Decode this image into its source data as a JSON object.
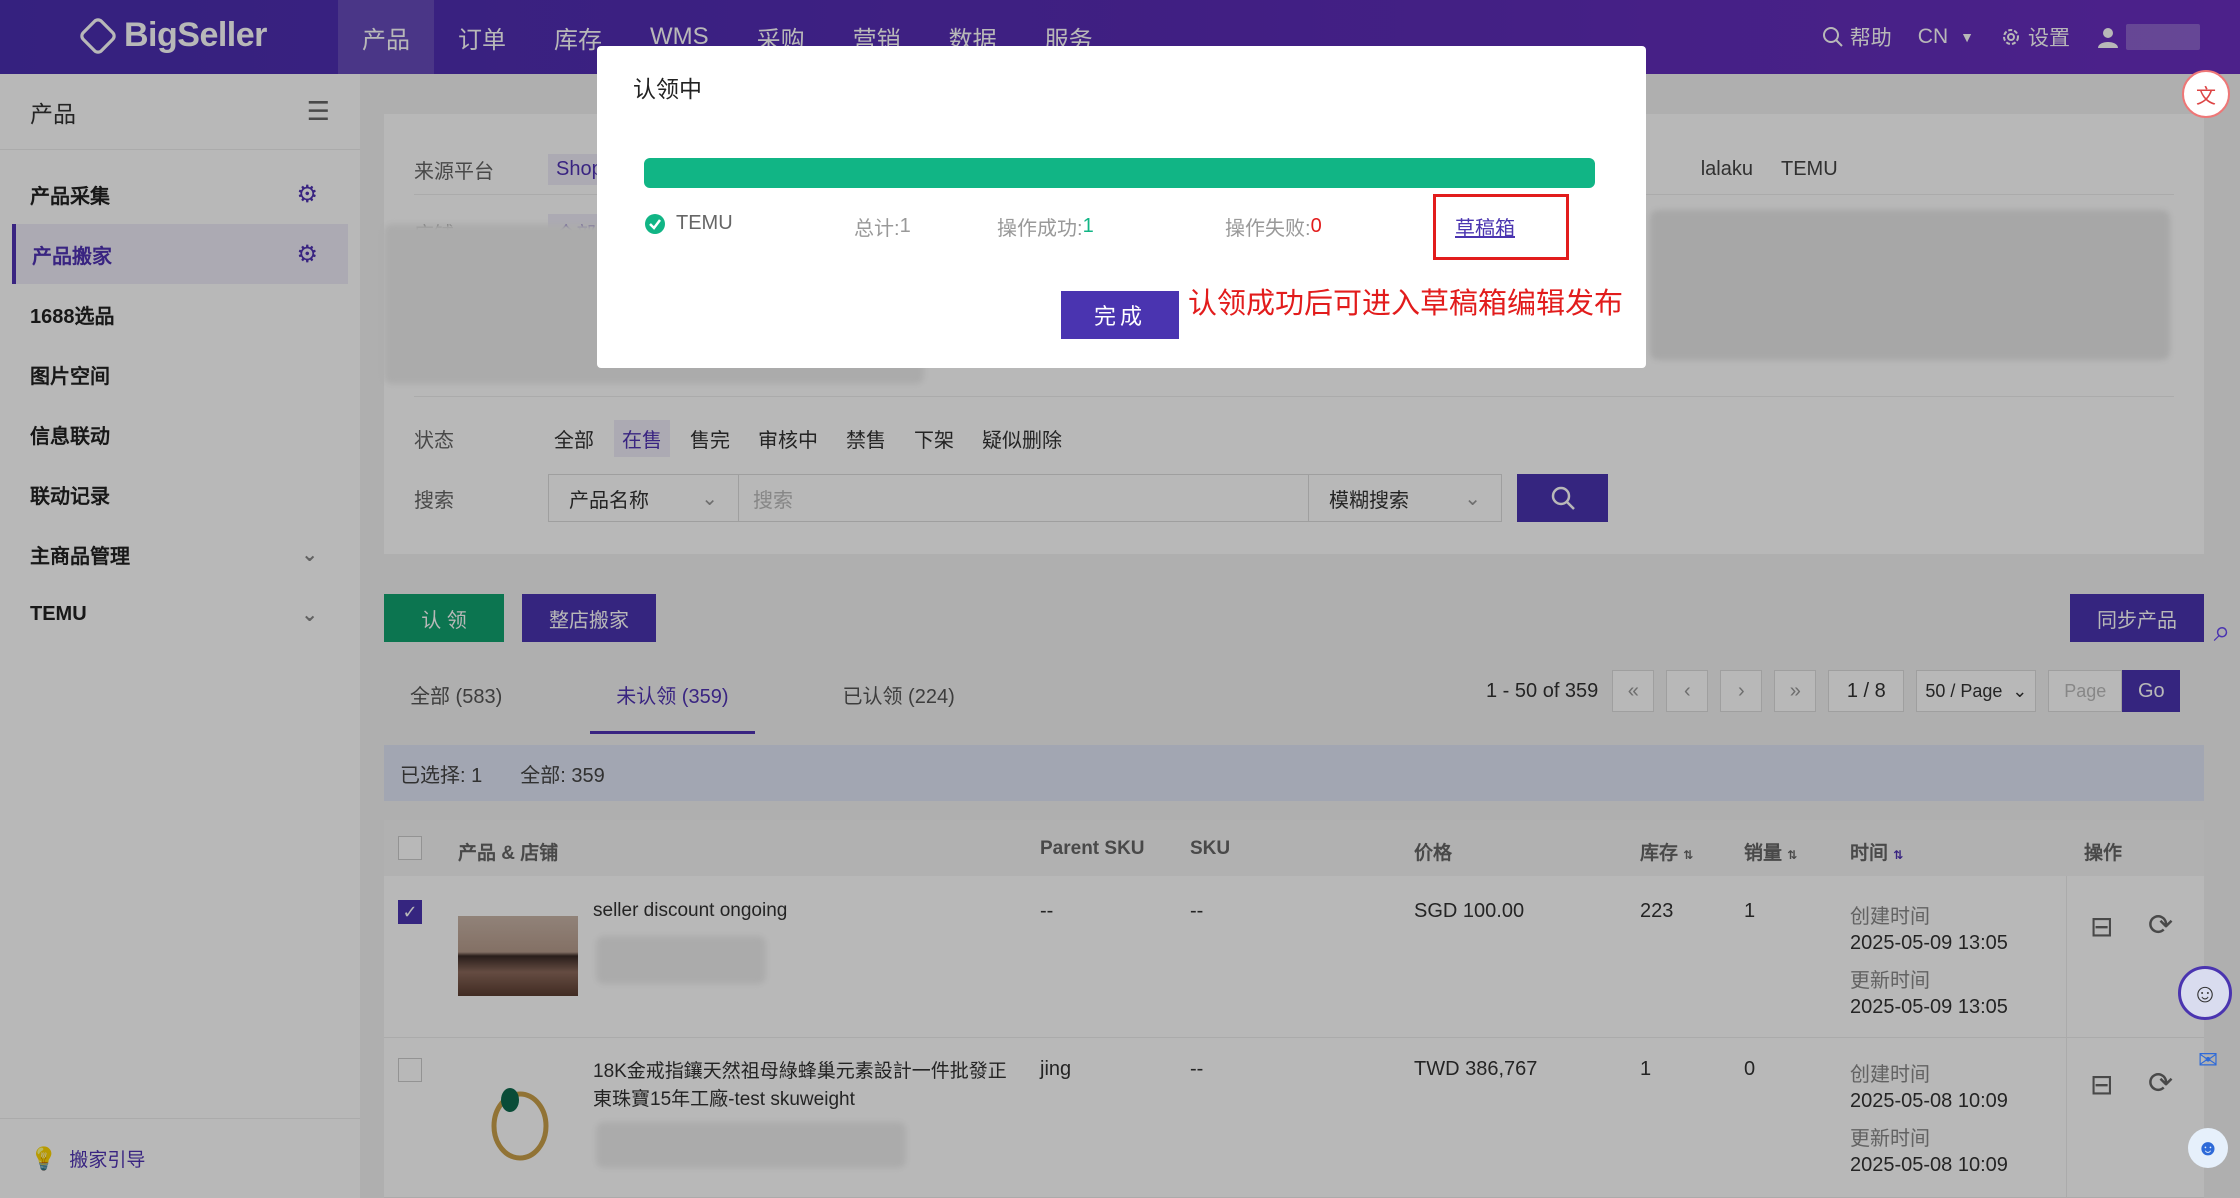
{
  "brand": {
    "name": "BigSeller"
  },
  "nav": {
    "items": [
      "产品",
      "订单",
      "库存",
      "WMS",
      "采购",
      "营销",
      "数据",
      "服务"
    ],
    "help": "帮助",
    "lang": "CN",
    "settings": "设置"
  },
  "sidebar": {
    "title": "产品",
    "items": [
      {
        "label": "产品采集"
      },
      {
        "label": "产品搬家"
      },
      {
        "label": "1688选品"
      },
      {
        "label": "图片空间"
      },
      {
        "label": "信息联动"
      },
      {
        "label": "联动记录"
      },
      {
        "label": "主商品管理"
      },
      {
        "label": "TEMU"
      }
    ],
    "footer": "搬家引导"
  },
  "filters": {
    "source_label": "来源平台",
    "source_first": "Shop",
    "source_mid": "lalaku",
    "source_last": "TEMU",
    "shop_label": "店铺",
    "shop_all": "全部",
    "status_label": "状态",
    "status_options": [
      "全部",
      "在售",
      "售完",
      "审核中",
      "禁售",
      "下架",
      "疑似删除"
    ],
    "search_label": "搜索",
    "search_field": "产品名称",
    "search_placeholder": "搜索",
    "search_mode": "模糊搜索"
  },
  "actions": {
    "claim": "认 领",
    "move_store": "整店搬家",
    "sync": "同步产品"
  },
  "tabs": [
    "全部 (583)",
    "未认领 (359)",
    "已认领 (224)"
  ],
  "pager": {
    "range": "1 - 50 of 359",
    "current": "1 / 8",
    "per_page": "50 / Page",
    "page_placeholder": "Page",
    "go": "Go"
  },
  "selection": {
    "selected": "已选择: 1",
    "total": "全部: 359"
  },
  "table": {
    "headers": [
      "产品 & 店铺",
      "Parent SKU",
      "SKU",
      "价格",
      "库存",
      "销量",
      "时间",
      "操作"
    ],
    "rows": [
      {
        "title": "seller discount ongoing",
        "parent_sku": "--",
        "sku": "--",
        "price": "SGD 100.00",
        "stock": "223",
        "sales": "1",
        "created_label": "创建时间",
        "created": "2025-05-09 13:05",
        "updated_label": "更新时间",
        "updated": "2025-05-09 13:05",
        "checked": true
      },
      {
        "title": "18K金戒指鑲天然祖母綠蜂巢元素設計一件批發正東珠寶15年工廠-test skuweight",
        "parent_sku": "jing",
        "sku": "--",
        "price": "TWD 386,767",
        "stock": "1",
        "sales": "0",
        "created_label": "创建时间",
        "created": "2025-05-08 10:09",
        "updated_label": "更新时间",
        "updated": "2025-05-08 10:09",
        "checked": false
      }
    ]
  },
  "modal": {
    "title": "认领中",
    "progress": 1.0,
    "platform": "TEMU",
    "total_label": "总计: ",
    "total": "1",
    "success_label": "操作成功: ",
    "success": "1",
    "fail_label": "操作失败: ",
    "fail": "0",
    "draft_link": "草稿箱",
    "done": "完成",
    "annotation": "认领成功后可进入草稿箱编辑发布"
  },
  "colors": {
    "brand": "#4a34b0",
    "success": "#11b585",
    "danger": "#e21c1c"
  }
}
